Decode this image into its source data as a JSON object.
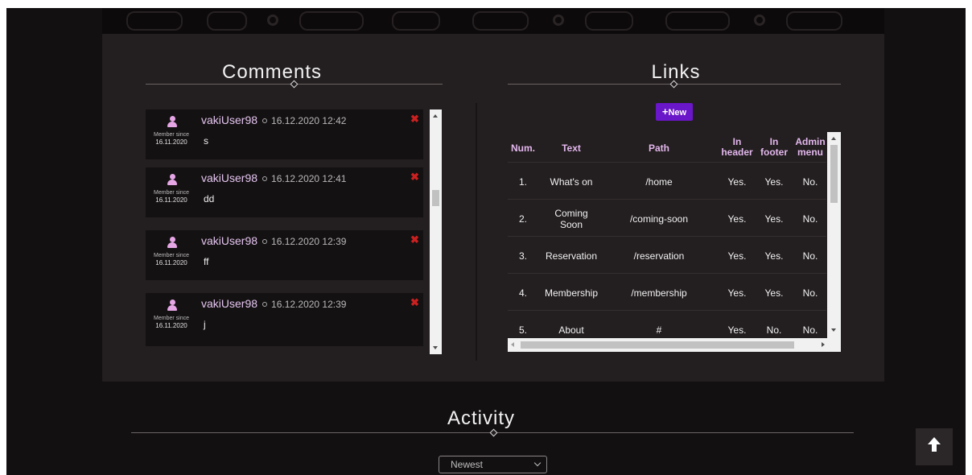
{
  "comments_section": {
    "title": "Comments",
    "items": [
      {
        "user": "vakiUser98",
        "date": "16.12.2020 12:42",
        "text": "s",
        "member_since_label": "Member since",
        "member_since": "16.11.2020",
        "delete_glyph": "✖"
      },
      {
        "user": "vakiUser98",
        "date": "16.12.2020 12:41",
        "text": "dd",
        "member_since_label": "Member since",
        "member_since": "16.11.2020",
        "delete_glyph": "✖"
      },
      {
        "user": "vakiUser98",
        "date": "16.12.2020 12:39",
        "text": "ff",
        "member_since_label": "Member since",
        "member_since": "16.11.2020",
        "delete_glyph": "✖"
      },
      {
        "user": "vakiUser98",
        "date": "16.12.2020 12:39",
        "text": "j",
        "member_since_label": "Member since",
        "member_since": "16.11.2020",
        "delete_glyph": "✖"
      }
    ]
  },
  "links_section": {
    "title": "Links",
    "new_button_icon": "+",
    "new_button_label": "New",
    "columns": [
      "Num.",
      "Text",
      "Path",
      "In header",
      "In footer",
      "Admin menu"
    ],
    "rows": [
      [
        "1.",
        "What's on",
        "/home",
        "Yes.",
        "Yes.",
        "No."
      ],
      [
        "2.",
        "Coming Soon",
        "/coming-soon",
        "Yes.",
        "Yes.",
        "No."
      ],
      [
        "3.",
        "Reservation",
        "/reservation",
        "Yes.",
        "Yes.",
        "No."
      ],
      [
        "4.",
        "Membership",
        "/membership",
        "Yes.",
        "Yes.",
        "No."
      ],
      [
        "5.",
        "About",
        "#",
        "Yes.",
        "No.",
        "No."
      ]
    ]
  },
  "activity_section": {
    "title": "Activity",
    "sort_selected": "Newest"
  },
  "icons": {
    "back_to_top": "arrow-up-icon",
    "avatar": "user-icon",
    "delete": "close-icon"
  },
  "colors": {
    "accent": "#6a16c9",
    "username": "#e3c4ef",
    "table_header": "#e3b8ee",
    "delete": "#cc2020"
  }
}
